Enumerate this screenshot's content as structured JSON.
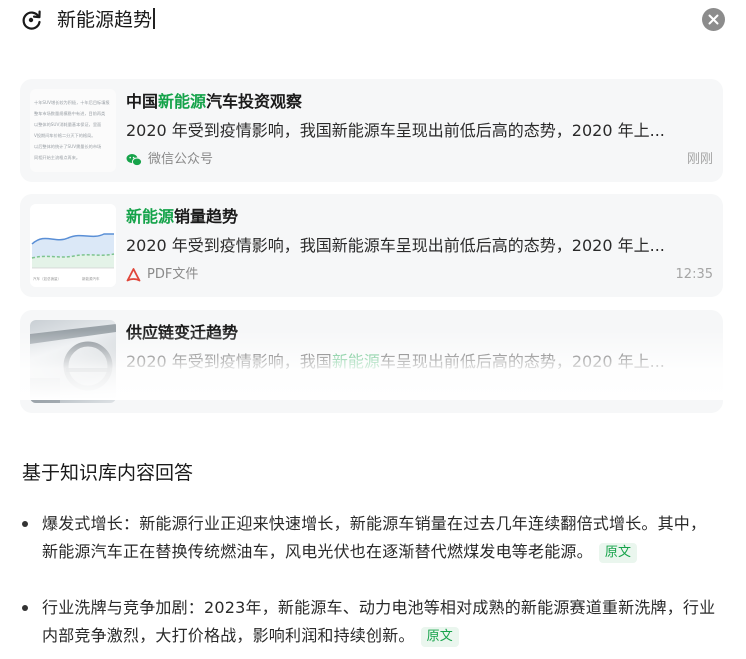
{
  "search": {
    "query": "新能源趋势"
  },
  "results": [
    {
      "title_hl": "新能源",
      "title_pre": "中国",
      "title_post": "汽车投资观察",
      "snippet": "2020 年受到疫情影响，我国新能源车呈现出前低后高的态势，2020 年上...",
      "source": "微信公众号",
      "source_icon": "wechat-icon",
      "time": "刚刚",
      "thumb_lines": [
        "十年SUV增长较为积极，十年后目标填报",
        "整车市场数量规模稳中有进，目前再类",
        "以整体的SUV消耗量基本保证，里面",
        "V投期间车价格二分灭下的格局。",
        "以后整体的统计了SUV需量长的市场",
        "同相开始主流格点再来。"
      ]
    },
    {
      "title_hl": "新能源",
      "title_post": "销量趋势",
      "snippet": "2020 年受到疫情影响，我国新能源车呈现出前低后高的态势，2020 年上...",
      "source": "PDF文件",
      "source_icon": "pdf-icon",
      "time": "12:35",
      "thumb_caption_left": "汽车（如总销量）",
      "thumb_caption_right": "新能源汽车",
      "chart_colors": [
        "#5a8fd6",
        "#7ec48f"
      ]
    },
    {
      "title": "供应链变迁趋势",
      "snippet_pre": "2020 年受到疫情影响，我国",
      "snippet_hl": "新能源",
      "snippet_post": "车呈现出前低后高的态势，2020 年上..."
    }
  ],
  "answer": {
    "heading": "基于知识库内容回答",
    "bullets": [
      {
        "text": "爆发式增长：新能源行业正迎来快速增长，新能源车销量在过去几年连续翻倍式增长。其中，新能源汽车正在替换传统燃油车，风电光伏也在逐渐替代燃煤发电等老能源。",
        "tag": "原文"
      },
      {
        "text": "行业洗牌与竞争加剧：2023年，新能源车、动力电池等相对成熟的新能源赛道重新洗牌，行业内部竞争激烈，大打价格战，影响利润和持续创新。",
        "tag": "原文"
      }
    ]
  },
  "colors": {
    "highlight": "#15a34a",
    "card_bg": "#f6f7f8",
    "tag_bg": "#eaf6ee"
  }
}
